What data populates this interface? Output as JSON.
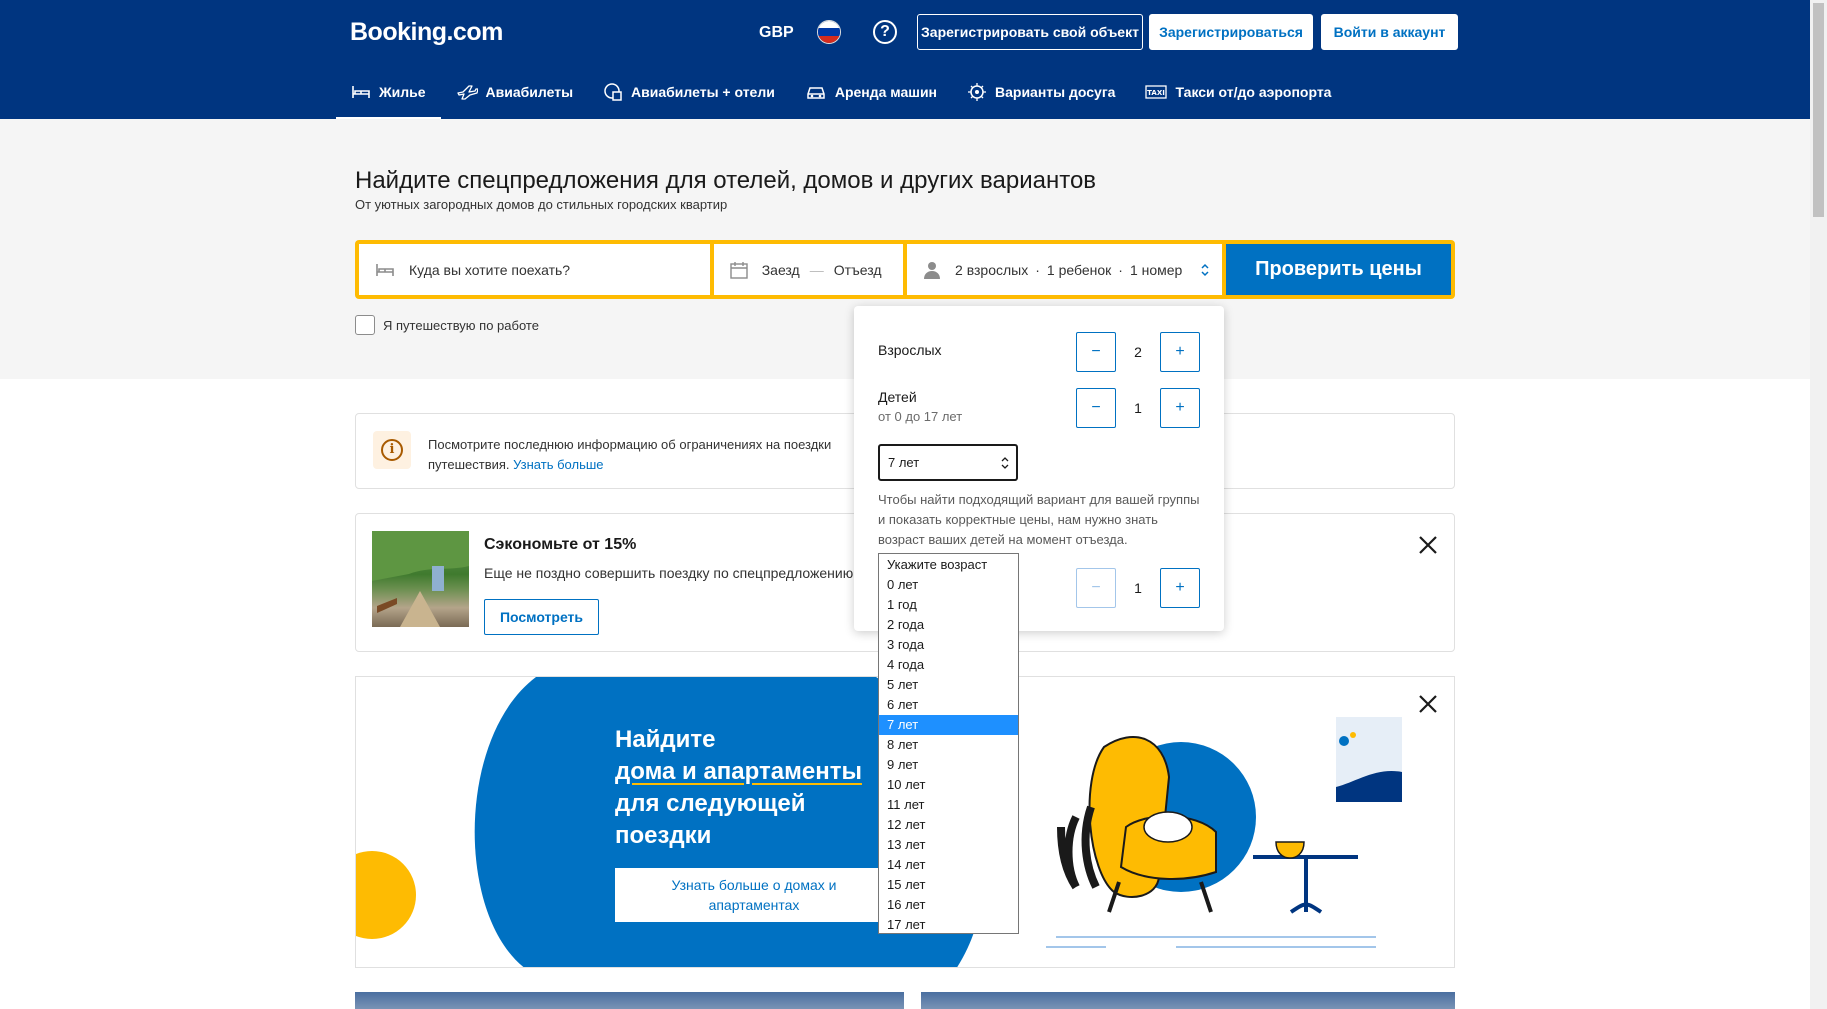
{
  "header": {
    "logo": "Booking.com",
    "currency": "GBP",
    "help": "?",
    "list_property": "Зарегистрировать свой объект",
    "register": "Зарегистрироваться",
    "signin": "Войти в аккаунт"
  },
  "nav": [
    {
      "label": "Жилье",
      "icon": "bed-icon",
      "active": true
    },
    {
      "label": "Авиабилеты",
      "icon": "plane-icon"
    },
    {
      "label": "Авиабилеты + отели",
      "icon": "flight-hotel-icon"
    },
    {
      "label": "Аренда машин",
      "icon": "car-icon"
    },
    {
      "label": "Варианты досуга",
      "icon": "attractions-icon"
    },
    {
      "label": "Такси от/до аэропорта",
      "icon": "taxi-icon"
    }
  ],
  "hero": {
    "title": "Найдите спецпредложения для отелей, домов и других вариантов",
    "subtitle": "От уютных загородных домов до стильных городских квартир"
  },
  "search": {
    "destination_placeholder": "Куда вы хотите поехать?",
    "checkin": "Заезд",
    "dash": "—",
    "checkout": "Отъезд",
    "adults": "2 взрослых",
    "children": "1 ребенок",
    "rooms": "1 номер",
    "separator": "·",
    "submit": "Проверить цены",
    "business_travel": "Я путешествую по работе"
  },
  "info": {
    "text": "Посмотрите последнюю информацию об ограничениях на поездки",
    "text2": "путешествия.",
    "link": "Узнать больше"
  },
  "promo": {
    "title": "Сэкономьте от 15%",
    "text": "Еще не поздно совершить поездку по спецпредложению",
    "button": "Посмотреть"
  },
  "banner": {
    "line1": "Найдите",
    "line2": "дома и апартаменты",
    "line3": "для следующей",
    "line4": "поездки",
    "button": "Узнать больше о домах и апартаментах"
  },
  "occupancy": {
    "adults_label": "Взрослых",
    "adults_value": "2",
    "children_label": "Детей",
    "children_sub": "от 0 до 17 лет",
    "children_value": "1",
    "child_age_selected": "7 лет",
    "note": "Чтобы найти подходящий вариант для вашей группы и показать корректные цены, нам нужно знать возраст ваших детей на момент отъезда.",
    "rooms_value": "1",
    "minus": "−",
    "plus": "+"
  },
  "age_options": [
    "Укажите возраст",
    "0 лет",
    "1 год",
    "2 года",
    "3 года",
    "4 года",
    "5 лет",
    "6 лет",
    "7 лет",
    "8 лет",
    "9 лет",
    "10 лет",
    "11 лет",
    "12 лет",
    "13 лет",
    "14 лет",
    "15 лет",
    "16 лет",
    "17 лет"
  ],
  "age_selected_index": 8,
  "colors": {
    "brand": "#003580",
    "accent": "#0071c2",
    "search_border": "#febb02"
  }
}
